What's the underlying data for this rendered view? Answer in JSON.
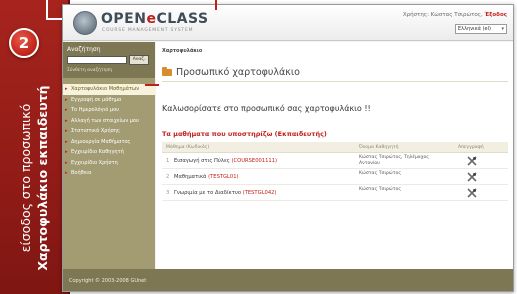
{
  "annotation": {
    "step_number": "2",
    "line1": "είσοδος στο προσωπικό",
    "line2": "Χαρτοφυλάκιο εκπαιδευτή"
  },
  "header": {
    "logo_text_a": "OPEN",
    "logo_text_accent": "e",
    "logo_text_b": "CLASS",
    "logo_subtitle": "COURSE MANAGEMENT SYSTEM",
    "user_prefix": "Χρήστης:",
    "user_name": "Κώστας Τσιρώτος",
    "logout_label": "Έξοδος",
    "language_selected": "Ελληνικά (el)"
  },
  "sidebar": {
    "search_title": "Αναζήτηση",
    "search_button": "Αναζ.",
    "advanced_search": "Σύνθετη αναζήτηση",
    "items": [
      {
        "label": "Χαρτοφυλάκιο Μαθημάτων",
        "active": true
      },
      {
        "label": "Εγγραφή σε μάθημα",
        "active": false
      },
      {
        "label": "Το Ημερολόγιό μου",
        "active": false
      },
      {
        "label": "Αλλαγή των στοιχείων μου",
        "active": false
      },
      {
        "label": "Στατιστικά Χρήσης",
        "active": false
      },
      {
        "label": "Δημιουργία Μαθήματος",
        "active": false
      },
      {
        "label": "Εγχειρίδιο Καθηγητή",
        "active": false
      },
      {
        "label": "Εγχειρίδιο Χρήστη",
        "active": false
      },
      {
        "label": "Βοήθεια",
        "active": false
      }
    ]
  },
  "main": {
    "breadcrumb": "Χαρτοφυλάκιο",
    "page_title": "Προσωπικό χαρτοφυλάκιο",
    "welcome": "Καλωσορίσατε στο προσωπικό σας χαρτοφυλάκιο !!",
    "courses_heading": "Τα μαθήματα που υποστηρίζω (Εκπαιδευτής)",
    "table_headers": {
      "course": "Μάθημα (Κωδικός)",
      "teacher": "Όνομα Καθηγητή",
      "action": "Απεγγραφή"
    },
    "courses": [
      {
        "num": "1",
        "name": "Εισαγωγή στις Πύλες",
        "code": "(COURSE001111)",
        "teacher": "Κώστας Τσιρώτος, Τηλέμαχος Αντονίου"
      },
      {
        "num": "2",
        "name": "Μαθηματικά",
        "code": "(TESTGL01)",
        "teacher": "Κώστας Τσιρώτος"
      },
      {
        "num": "3",
        "name": "Γνωριμία με το Διαδίκτυο",
        "code": "(TESTGL042)",
        "teacher": "Κώστας Τσιρώτος"
      }
    ]
  },
  "footer": {
    "copyright": "Copyright © 2003-2008 GUnet"
  },
  "colors": {
    "accent": "#c0201a",
    "sidebar": "#a39c72",
    "sidebar_dark": "#7d7753"
  }
}
